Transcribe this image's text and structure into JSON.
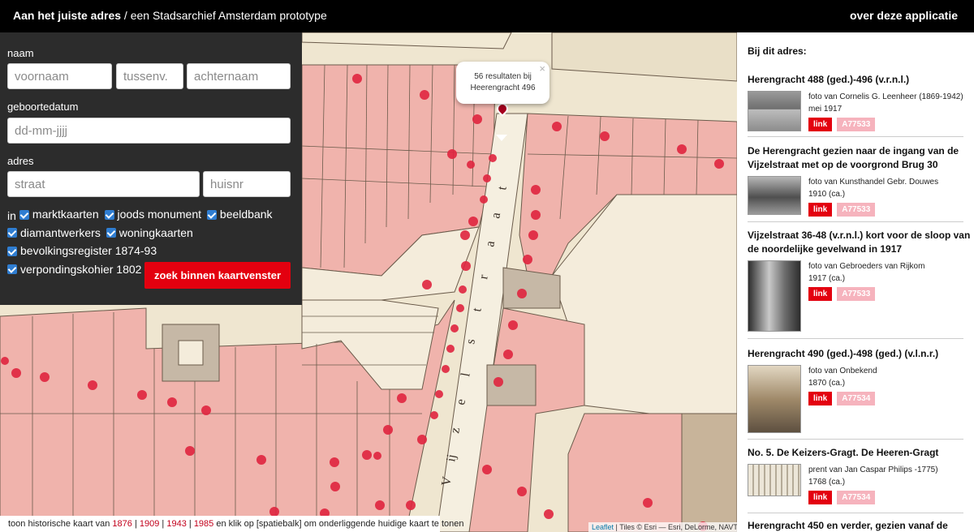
{
  "header": {
    "brand_bold": "Aan het juiste adres",
    "brand_rest": " / een Stadsarchief Amsterdam prototype",
    "about_label": "over deze applicatie"
  },
  "search": {
    "name_label": "naam",
    "first_name_placeholder": "voornaam",
    "infix_placeholder": "tussenv.",
    "last_name_placeholder": "achternaam",
    "birthdate_label": "geboortedatum",
    "birthdate_placeholder": "dd-mm-jjjj",
    "address_label": "adres",
    "street_placeholder": "straat",
    "number_placeholder": "huisnr",
    "in_label": "in",
    "sources": [
      "marktkaarten",
      "joods monument",
      "beeldbank",
      "diamantwerkers",
      "woningkaarten",
      "bevolkingsregister 1874-93",
      "verpondingskohier 1802"
    ],
    "button_label": "zoek binnen kaartvenster"
  },
  "popup": {
    "line1": "56 resultaten bij",
    "line2": "Heerengracht 496",
    "close": "×"
  },
  "map_labels": {
    "street": "Vijzelstraat",
    "letters": [
      "V",
      "ij",
      "z",
      "e",
      "l",
      "s",
      "t",
      "r",
      "a",
      "a",
      "t"
    ]
  },
  "bottom": {
    "prefix": "toon historische kaart van ",
    "years": [
      "1876",
      "1909",
      "1943",
      "1985"
    ],
    "suffix": " en klik op [spatiebalk] om onderliggende huidige kaart te tonen"
  },
  "attribution": {
    "leaflet": "Leaflet",
    "rest": " | Tiles © Esri — Esri, DeLorme, NAVTEQ"
  },
  "panel": {
    "title": "Bij dit adres:",
    "items": [
      {
        "title": "Herengracht 488 (ged.)-496 (v.r.n.l.)",
        "meta": [
          "foto van Cornelis G. Leenheer (1869-1942)",
          "mei 1917"
        ],
        "link": "link",
        "id": "A77533"
      },
      {
        "title": "De Herengracht gezien naar de ingang van de Vijzelstraat met op de voorgrond Brug 30",
        "meta": [
          "foto van Kunsthandel Gebr. Douwes",
          "1910 (ca.)"
        ],
        "link": "link",
        "id": "A77533"
      },
      {
        "title": "Vijzelstraat 36-48 (v.r.n.l.) kort voor de sloop van de noordelijke gevelwand in 1917",
        "meta": [
          "foto van Gebroeders van Rijkom",
          "1917 (ca.)"
        ],
        "link": "link",
        "id": "A77533"
      },
      {
        "title": "Herengracht 490 (ged.)-498 (ged.) (v.l.n.r.)",
        "meta": [
          "foto van Onbekend",
          "1870 (ca.)"
        ],
        "link": "link",
        "id": "A77534"
      },
      {
        "title": "No. 5. De Keizers-Gragt. De Heeren-Gragt",
        "meta": [
          "prent van Jan Caspar Philips -1775)",
          "1768 (ca.)"
        ],
        "link": "link",
        "id": "A77534"
      },
      {
        "title": "Herengracht 450 en verder, gezien vanaf de",
        "meta": [],
        "link": "",
        "id": ""
      }
    ]
  },
  "colors": {
    "accent_red": "#e3000f",
    "marker_dark_red": "#a5001e",
    "result_dot": "#e0253f",
    "tag_pink": "#f6b3bd",
    "panel_dark": "#2c2c2c",
    "parcel_pink": "#f0b3ac",
    "parcel_grey": "#c6b8a6",
    "paper": "#efe6d0"
  }
}
